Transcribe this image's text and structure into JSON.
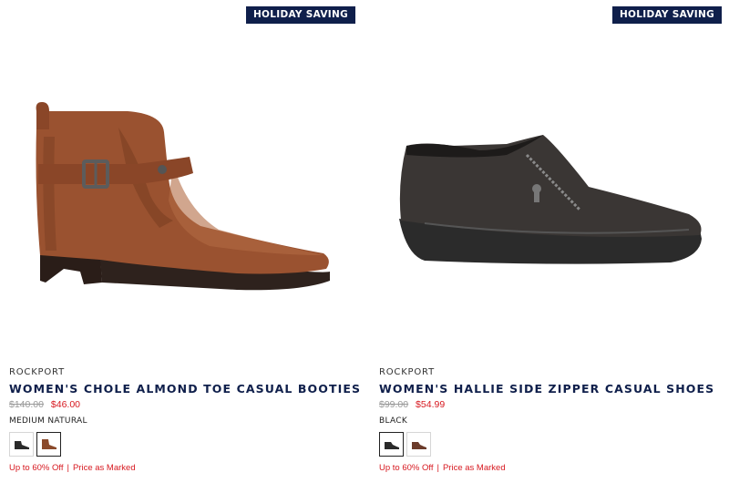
{
  "products": [
    {
      "badge": "HOLIDAY SAVING",
      "brand": "ROCKPORT",
      "name": "WOMEN'S CHOLE ALMOND TOE CASUAL BOOTIES",
      "original_price": "$140.00",
      "sale_price": "$46.00",
      "color_name": "MEDIUM NATURAL",
      "swatches": [
        {
          "icon": "black-shoe-swatch-icon",
          "color": "#2a2a2a",
          "selected": false
        },
        {
          "icon": "brown-shoe-swatch-icon",
          "color": "#8b4a2b",
          "selected": true
        }
      ],
      "promo_text": "Up to 60% Off",
      "promo_link": "Price as Marked"
    },
    {
      "badge": "HOLIDAY SAVING",
      "brand": "ROCKPORT",
      "name": "WOMEN'S HALLIE SIDE ZIPPER CASUAL SHOES",
      "original_price": "$99.00",
      "sale_price": "$54.99",
      "color_name": "BLACK",
      "swatches": [
        {
          "icon": "black-shoe-swatch-icon",
          "color": "#2a2a2a",
          "selected": true
        },
        {
          "icon": "brown-shoe-swatch-icon",
          "color": "#6b3b2a",
          "selected": false
        }
      ],
      "promo_text": "Up to 60% Off",
      "promo_link": "Price as Marked"
    }
  ],
  "colors": {
    "badge_bg": "#0f1f4b",
    "title": "#0f1f4b",
    "sale": "#d71920"
  }
}
